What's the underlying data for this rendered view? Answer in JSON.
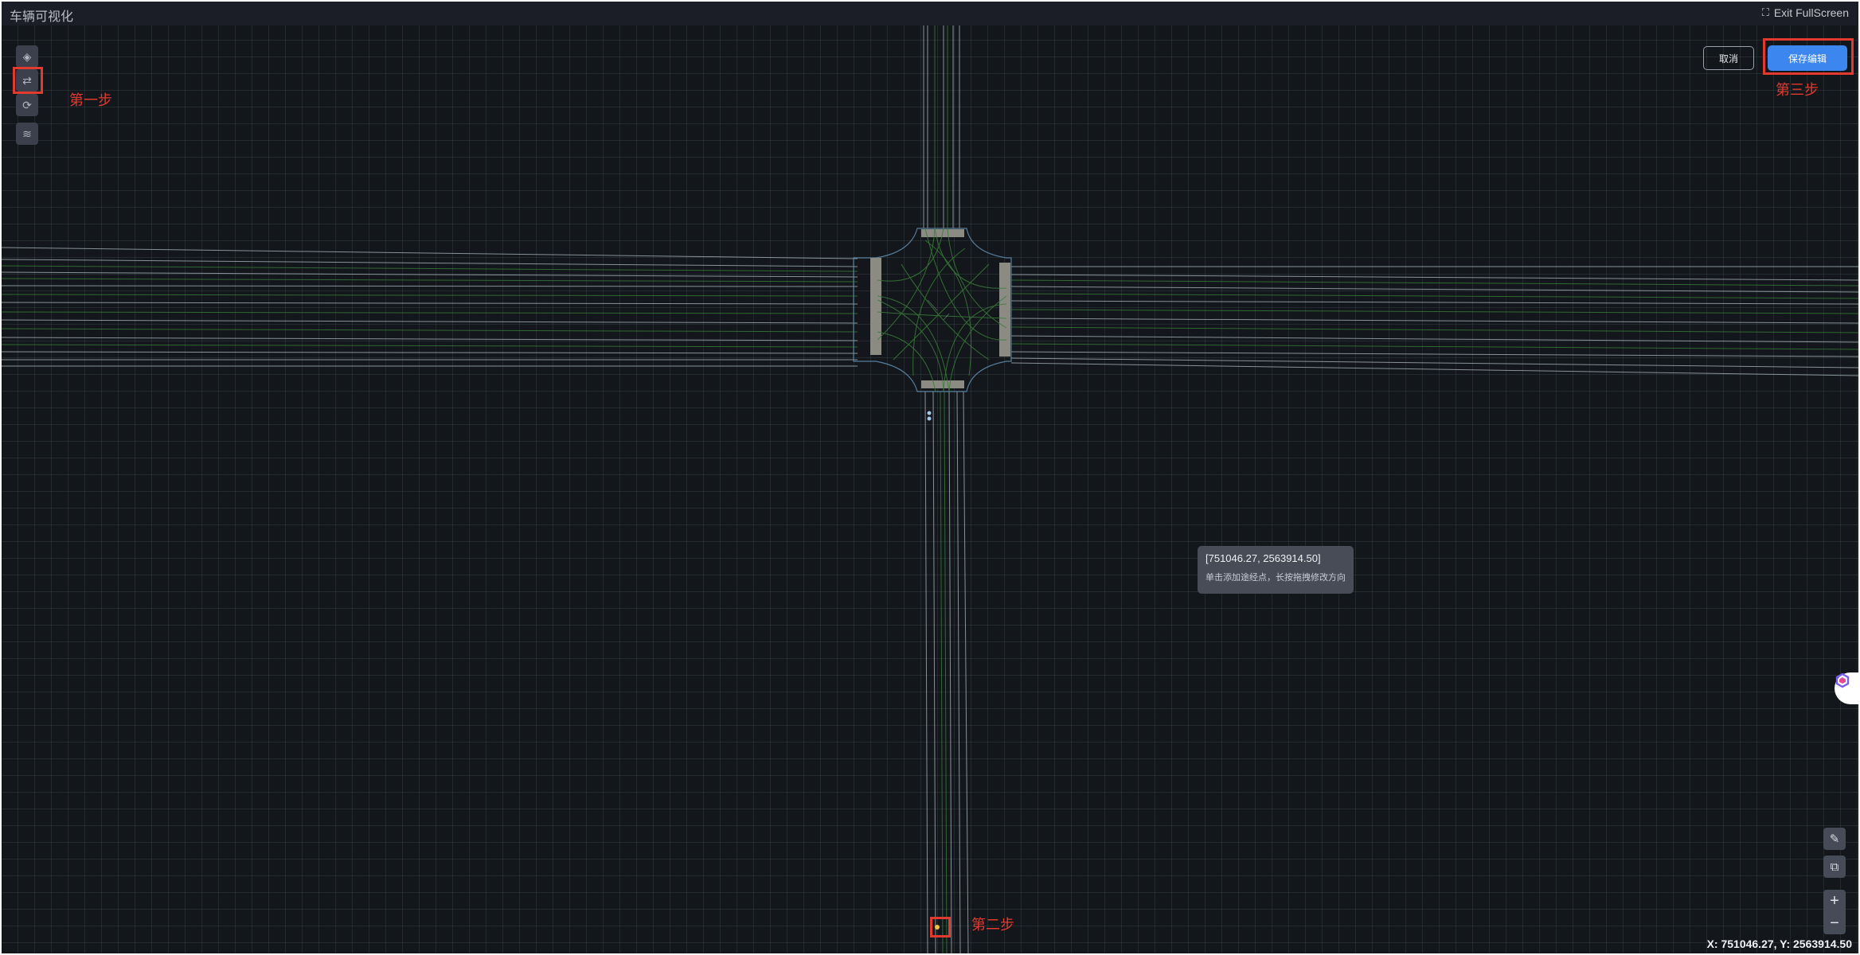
{
  "app": {
    "title": "车辆可视化",
    "exit_fullscreen": "Exit FullScreen"
  },
  "toolbar": {
    "tools": [
      {
        "icon": "locate-icon"
      },
      {
        "icon": "route-edit-icon"
      },
      {
        "icon": "cycle-icon"
      },
      {
        "icon": "layers-icon"
      }
    ]
  },
  "actions": {
    "cancel": "取消",
    "save": "保存编辑"
  },
  "annotations": {
    "step1": "第一步",
    "step2": "第二步",
    "step3": "第三步"
  },
  "tooltip": {
    "coord": "[751046.27, 2563914.50]",
    "hint": "单击添加途经点，长按拖拽修改方向"
  },
  "map_controls": {
    "ruler_icon": "ruler-icon",
    "copy_icon": "copy-icon",
    "zoom_in": "+",
    "zoom_out": "−"
  },
  "status": {
    "coordinates": "X: 751046.27, Y: 2563914.50"
  },
  "colors": {
    "highlight": "#e23a2f",
    "accent": "#3c86f0",
    "lane_green": "#3a7d3a",
    "road_line": "#aebbc2"
  }
}
